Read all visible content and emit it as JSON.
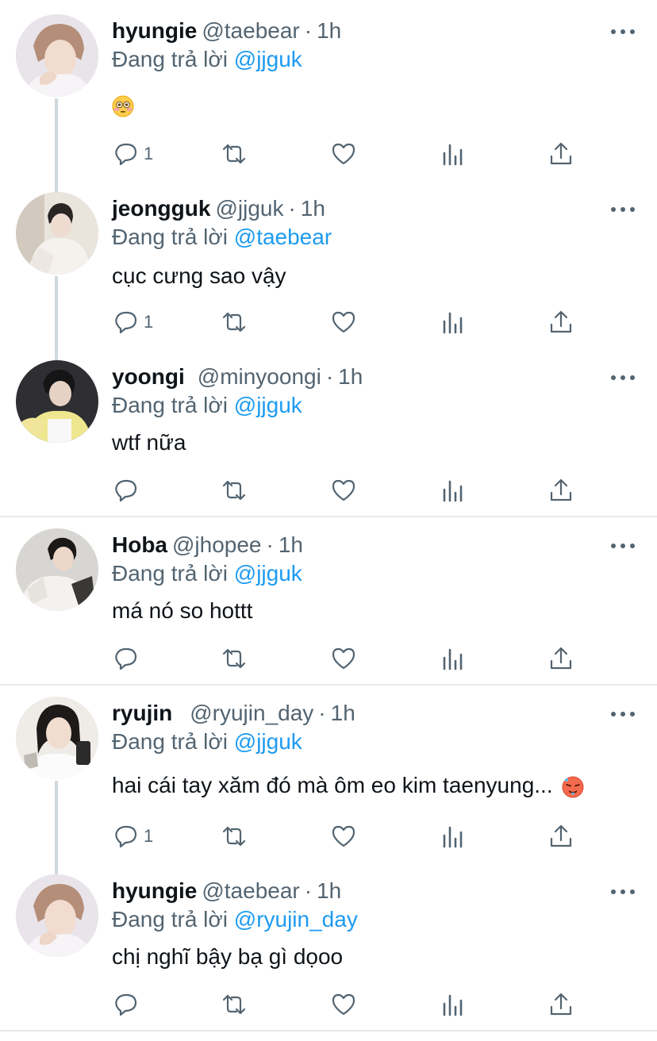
{
  "reply_prefix": "Đang trả lời",
  "tweets": [
    {
      "name": "hyungie",
      "handle": "@taebear",
      "dot": "·",
      "time": "1h",
      "reply_to": "@jjguk",
      "text": "",
      "emoji": "flushed-face",
      "reply_count": "1",
      "avatar_tint": "#c9b8b0"
    },
    {
      "name": "jeongguk",
      "handle": "@jjguk",
      "dot": "·",
      "time": "1h",
      "reply_to": "@taebear",
      "text": "cục cưng sao vậy",
      "reply_count": "1",
      "avatar_tint": "#cfcac3"
    },
    {
      "name": "yoongi",
      "handle": "@minyoongi",
      "dot": "·",
      "time": "1h",
      "reply_to": "@jjguk",
      "text": "wtf nữa",
      "reply_count": "",
      "avatar_tint": "#3a3a3a"
    },
    {
      "name": "Hoba",
      "handle": "@jhopee",
      "dot": "·",
      "time": "1h",
      "reply_to": "@jjguk",
      "text": "má nó so hottt",
      "reply_count": "",
      "avatar_tint": "#b9b6b2"
    },
    {
      "name": "ryujin",
      "handle": "@ryujin_day",
      "dot": "·",
      "time": "1h",
      "reply_to": "@jjguk",
      "text": "hai cái tay xăm đó mà ôm eo kim taenyung...",
      "emoji": "hot-face",
      "reply_count": "1",
      "avatar_tint": "#d8cfc7"
    },
    {
      "name": "hyungie",
      "handle": "@taebear",
      "dot": "·",
      "time": "1h",
      "reply_to": "@ryujin_day",
      "text": "chị nghĩ bậy bạ gì dọoo",
      "reply_count": "",
      "avatar_tint": "#c9b8b0"
    }
  ],
  "colors": {
    "accent": "#1d9bf0",
    "secondary_text": "#536471",
    "thread_line": "#cfd9de",
    "divider": "#e6e9ea"
  },
  "icons": [
    "more-icon",
    "reply-icon",
    "retweet-icon",
    "like-icon",
    "stats-icon",
    "share-icon"
  ]
}
